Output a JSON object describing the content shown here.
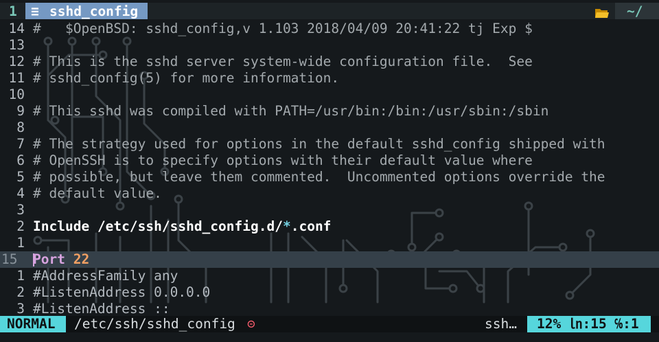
{
  "tabline": {
    "tab_number": "1",
    "file_icon": "≡",
    "file_name": "sshd_config",
    "cwd": "~/"
  },
  "editor": {
    "lines": [
      {
        "num": "14",
        "text": "#   $OpenBSD: sshd_config,v 1.103 2018/04/09 20:41:22 tj Exp $"
      },
      {
        "num": "13",
        "text": ""
      },
      {
        "num": "12",
        "text": "# This is the sshd server system-wide configuration file.  See"
      },
      {
        "num": "11",
        "text": "# sshd_config(5) for more information."
      },
      {
        "num": "10",
        "text": ""
      },
      {
        "num": "9",
        "text": "# This sshd was compiled with PATH=/usr/bin:/bin:/usr/sbin:/sbin"
      },
      {
        "num": "8",
        "text": ""
      },
      {
        "num": "7",
        "text": "# The strategy used for options in the default sshd_config shipped with"
      },
      {
        "num": "6",
        "text": "# OpenSSH is to specify options with their default value where"
      },
      {
        "num": "5",
        "text": "# possible, but leave them commented.  Uncommented options override the"
      },
      {
        "num": "4",
        "text": "# default value."
      },
      {
        "num": "3",
        "text": ""
      },
      {
        "num": "2",
        "include_kw": "Include",
        "include_path": "/etc/ssh/sshd_config.d/",
        "include_glob": "*",
        "include_ext": ".conf"
      },
      {
        "num": "1",
        "text": ""
      },
      {
        "num": "15",
        "directive": "Port",
        "value": "22"
      },
      {
        "num": "1",
        "text": "#AddressFamily any"
      },
      {
        "num": "2",
        "text": "#ListenAddress 0.0.0.0"
      },
      {
        "num": "3",
        "text": "#ListenAddress ::"
      }
    ]
  },
  "statusline": {
    "mode": "NORMAL",
    "path": "/etc/ssh/sshd_config",
    "readonly_icon": "⊝",
    "filetype": "ssh…",
    "position": "12% ㏑:15 ℅:1"
  },
  "colors": {
    "background": "#15191c",
    "tab_active": "#7599c3",
    "mode_accent": "#56d6dc",
    "cursorline": "#354049",
    "keyword": "#d7a3df",
    "number": "#f2a063"
  }
}
